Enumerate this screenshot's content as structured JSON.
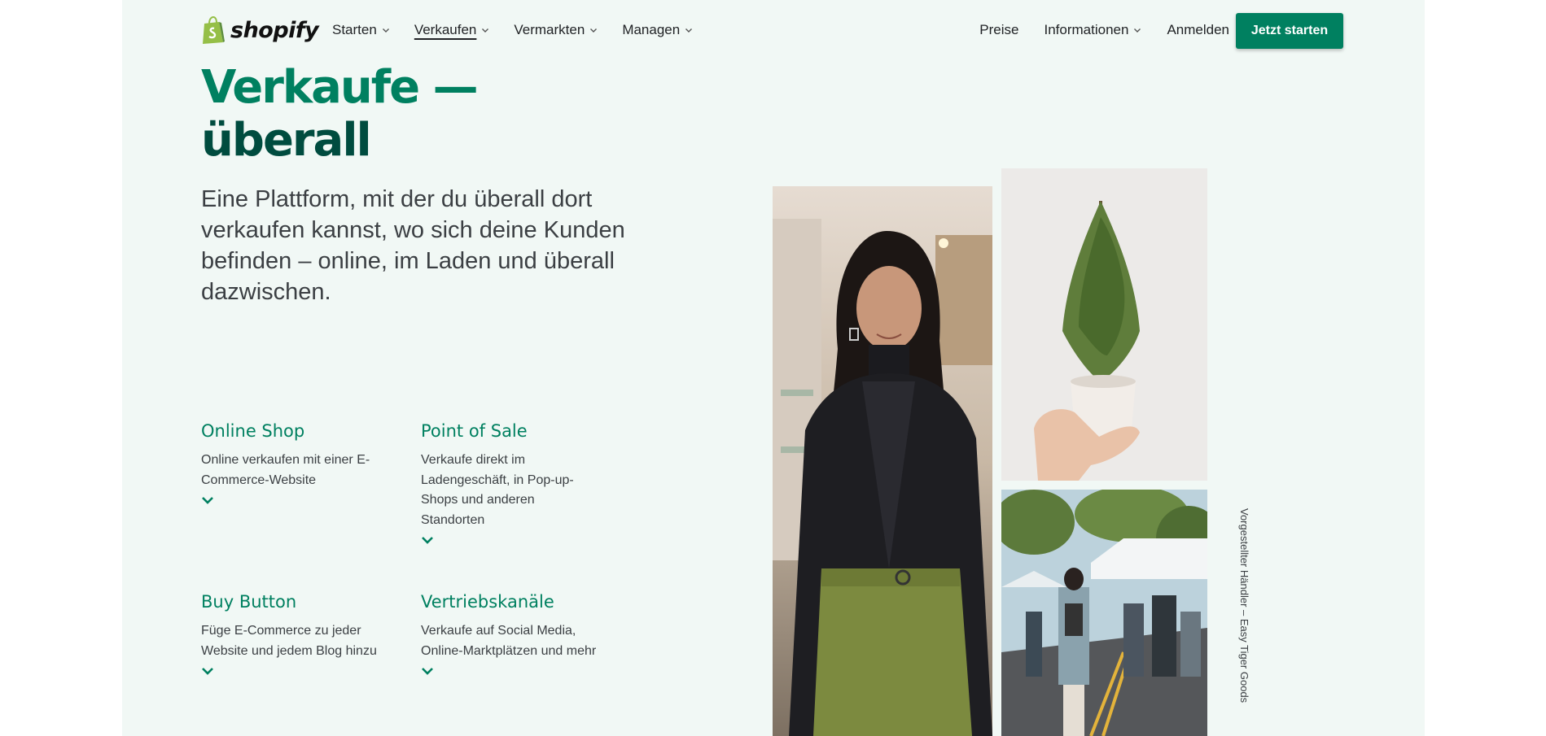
{
  "brand": {
    "logo_text": "shopify",
    "accent": "#008060",
    "dark": "#004c3f",
    "background": "#f1f8f5"
  },
  "nav": {
    "items": [
      {
        "label": "Starten",
        "active": false
      },
      {
        "label": "Verkaufen",
        "active": true
      },
      {
        "label": "Vermarkten",
        "active": false
      },
      {
        "label": "Managen",
        "active": false
      }
    ],
    "right": {
      "pricing": "Preise",
      "info": "Informationen",
      "login": "Anmelden"
    },
    "cta_label": "Jetzt starten"
  },
  "hero": {
    "title_line1": "Verkaufe —",
    "title_line2": "überall",
    "subtitle": "Eine Plattform, mit der du überall dort verkaufen kannst, wo sich deine Kunden befinden – online, im Laden und überall dazwischen."
  },
  "features": [
    {
      "title": "Online Shop",
      "text": "Online verkaufen mit einer E-Commerce-Website"
    },
    {
      "title": "Point of Sale",
      "text": "Verkaufe direkt im Ladengeschäft, in Pop-up-Shops und anderen Standorten"
    },
    {
      "title": "Buy Button",
      "text": "Füge E-Commerce zu jeder Website und jedem Blog hinzu"
    },
    {
      "title": "Vertriebskanäle",
      "text": "Verkaufe auf Social Media, Online-Marktplätzen und mehr"
    }
  ],
  "images": {
    "caption": "Vorgestellter Händler – Easy Tiger Goods"
  }
}
